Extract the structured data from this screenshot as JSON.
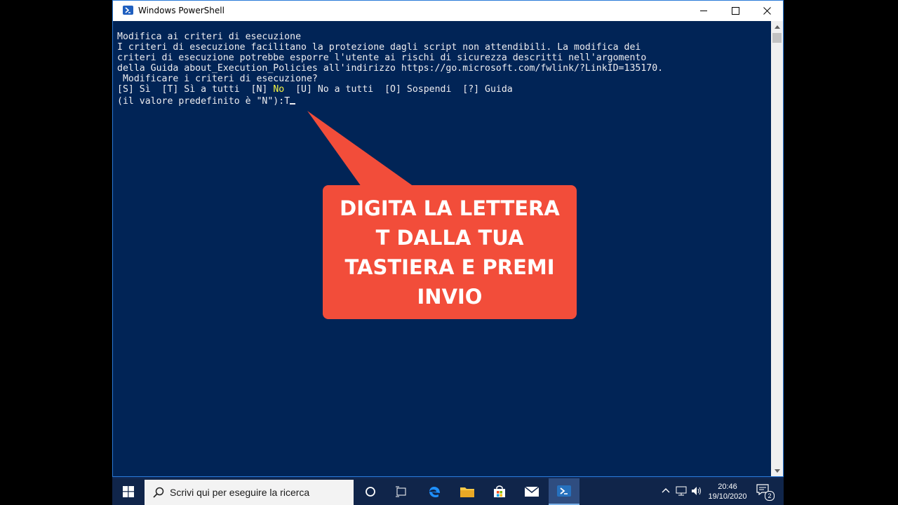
{
  "window": {
    "title": "Windows PowerShell"
  },
  "console": {
    "lines": [
      "Modifica ai criteri di esecuzione",
      "I criteri di esecuzione facilitano la protezione dagli script non attendibili. La modifica dei",
      "criteri di esecuzione potrebbe esporre l'utente ai rischi di sicurezza descritti nell'argomento",
      "della Guida about_Execution_Policies all'indirizzo https://go.microsoft.com/fwlink/?LinkID=135170.",
      " Modificare i criteri di esecuzione?"
    ],
    "options_prefix": "[S] Sì  [T] Sì a tutti  [N] ",
    "options_highlight": "No",
    "options_suffix": "  [U] No a tutti  [O] Sospendi  [?] Guida",
    "prompt": "(il valore predefinito è \"N\"):",
    "typed": "T"
  },
  "callout": {
    "text": "DIGITA LA LETTERA T DALLA TUA TASTIERA E PREMI INVIO",
    "color": "#f24d3a"
  },
  "taskbar": {
    "search_placeholder": "Scrivi qui per eseguire la ricerca",
    "time": "20:46",
    "date": "19/10/2020",
    "notification_count": "2",
    "pinned": [
      "task-view-icon",
      "edge-icon",
      "file-explorer-icon",
      "store-icon",
      "mail-icon",
      "powershell-icon"
    ]
  },
  "colors": {
    "console_bg": "#012456",
    "console_fg": "#eeedf0",
    "highlight": "#f5f543",
    "taskbar_bg": "#10254a"
  }
}
